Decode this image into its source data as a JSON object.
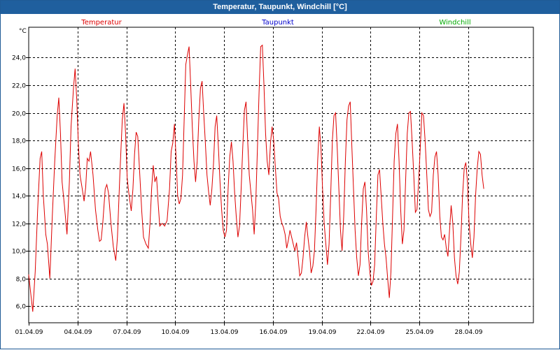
{
  "window": {
    "title": "Temperatur, Taupunkt, Windchill [°C]"
  },
  "colors": {
    "temperature": "#dd0000",
    "dewpoint": "#0000cc",
    "windchill": "#00aa00",
    "titlebar": "#1f5f9e",
    "grid": "#000000"
  },
  "chart_data": {
    "type": "line",
    "title": "Temperatur, Taupunkt, Windchill [°C]",
    "ylabel": "°C",
    "ylim": [
      4.8,
      26.2
    ],
    "xlim": [
      0,
      31
    ],
    "grid": true,
    "legend_position": "top",
    "x_tick_labels": [
      "01.04.09",
      "04.04.09",
      "07.04.09",
      "10.04.09",
      "13.04.09",
      "16.04.09",
      "19.04.09",
      "22.04.09",
      "25.04.09",
      "28.04.09"
    ],
    "x_tick_values": [
      0,
      3,
      6,
      9,
      12,
      15,
      18,
      21,
      24,
      27
    ],
    "y_ticks": [
      6.0,
      8.0,
      10.0,
      12.0,
      14.0,
      16.0,
      18.0,
      20.0,
      22.0,
      24.0
    ],
    "y_tick_labels": [
      "6,0",
      "8,0",
      "10,0",
      "12,0",
      "14,0",
      "16,0",
      "18,0",
      "20,0",
      "22,0",
      "24,0"
    ],
    "series": [
      {
        "name": "Temperatur",
        "color": "#dd0000",
        "points": [
          [
            0,
            8.3
          ],
          [
            0.1,
            7.2
          ],
          [
            0.25,
            5.6
          ],
          [
            0.4,
            8.5
          ],
          [
            0.55,
            13.0
          ],
          [
            0.7,
            16.7
          ],
          [
            0.8,
            17.2
          ],
          [
            0.9,
            14.0
          ],
          [
            1.05,
            11.2
          ],
          [
            1.15,
            10.5
          ],
          [
            1.3,
            8.0
          ],
          [
            1.45,
            12.5
          ],
          [
            1.6,
            16.5
          ],
          [
            1.75,
            19.8
          ],
          [
            1.85,
            21.1
          ],
          [
            1.95,
            18.5
          ],
          [
            2.05,
            15.0
          ],
          [
            2.2,
            13.2
          ],
          [
            2.35,
            11.2
          ],
          [
            2.5,
            15.0
          ],
          [
            2.6,
            19.0
          ],
          [
            2.75,
            21.8
          ],
          [
            2.85,
            23.2
          ],
          [
            2.95,
            21.0
          ],
          [
            3.05,
            17.8
          ],
          [
            3.15,
            15.5
          ],
          [
            3.3,
            14.4
          ],
          [
            3.4,
            13.6
          ],
          [
            3.5,
            14.6
          ],
          [
            3.6,
            16.7
          ],
          [
            3.7,
            16.5
          ],
          [
            3.8,
            17.2
          ],
          [
            3.95,
            15.5
          ],
          [
            4.1,
            13.0
          ],
          [
            4.25,
            11.5
          ],
          [
            4.35,
            10.7
          ],
          [
            4.45,
            10.8
          ],
          [
            4.55,
            12.0
          ],
          [
            4.7,
            14.5
          ],
          [
            4.8,
            14.8
          ],
          [
            4.9,
            14.2
          ],
          [
            5.05,
            12.0
          ],
          [
            5.2,
            10.3
          ],
          [
            5.35,
            9.3
          ],
          [
            5.45,
            11.0
          ],
          [
            5.6,
            15.5
          ],
          [
            5.75,
            19.5
          ],
          [
            5.85,
            20.7
          ],
          [
            5.95,
            18.5
          ],
          [
            6.05,
            15.3
          ],
          [
            6.15,
            14.2
          ],
          [
            6.3,
            12.9
          ],
          [
            6.4,
            14.5
          ],
          [
            6.5,
            17.0
          ],
          [
            6.6,
            18.6
          ],
          [
            6.7,
            18.3
          ],
          [
            6.8,
            16.0
          ],
          [
            6.95,
            12.8
          ],
          [
            7.05,
            11.0
          ],
          [
            7.2,
            10.5
          ],
          [
            7.35,
            10.2
          ],
          [
            7.45,
            12.0
          ],
          [
            7.55,
            14.5
          ],
          [
            7.65,
            16.2
          ],
          [
            7.75,
            15.0
          ],
          [
            7.85,
            15.4
          ],
          [
            7.95,
            13.5
          ],
          [
            8.05,
            11.8
          ],
          [
            8.2,
            12.0
          ],
          [
            8.35,
            11.8
          ],
          [
            8.5,
            12.2
          ],
          [
            8.65,
            14.5
          ],
          [
            8.75,
            17.2
          ],
          [
            8.85,
            17.8
          ],
          [
            8.95,
            19.2
          ],
          [
            9.05,
            16.8
          ],
          [
            9.15,
            14.0
          ],
          [
            9.25,
            13.4
          ],
          [
            9.35,
            13.8
          ],
          [
            9.45,
            15.5
          ],
          [
            9.55,
            19.5
          ],
          [
            9.65,
            23.5
          ],
          [
            9.75,
            24.2
          ],
          [
            9.85,
            24.8
          ],
          [
            9.95,
            22.0
          ],
          [
            10.05,
            19.0
          ],
          [
            10.15,
            16.5
          ],
          [
            10.25,
            15.0
          ],
          [
            10.35,
            16.5
          ],
          [
            10.45,
            19.5
          ],
          [
            10.55,
            21.8
          ],
          [
            10.65,
            22.3
          ],
          [
            10.75,
            20.0
          ],
          [
            10.85,
            17.8
          ],
          [
            10.95,
            15.5
          ],
          [
            11.05,
            14.3
          ],
          [
            11.15,
            13.3
          ],
          [
            11.25,
            14.5
          ],
          [
            11.35,
            16.3
          ],
          [
            11.45,
            19.0
          ],
          [
            11.55,
            19.8
          ],
          [
            11.65,
            17.5
          ],
          [
            11.75,
            15.0
          ],
          [
            11.85,
            13.0
          ],
          [
            11.95,
            11.5
          ],
          [
            12.05,
            11.0
          ],
          [
            12.15,
            11.5
          ],
          [
            12.25,
            14.5
          ],
          [
            12.35,
            16.8
          ],
          [
            12.45,
            17.9
          ],
          [
            12.55,
            16.5
          ],
          [
            12.65,
            14.2
          ],
          [
            12.75,
            12.5
          ],
          [
            12.85,
            11.0
          ],
          [
            12.95,
            11.8
          ],
          [
            13.05,
            14.5
          ],
          [
            13.15,
            17.5
          ],
          [
            13.25,
            20.2
          ],
          [
            13.35,
            20.8
          ],
          [
            13.45,
            18.0
          ],
          [
            13.55,
            15.5
          ],
          [
            13.65,
            14.2
          ],
          [
            13.75,
            13.0
          ],
          [
            13.85,
            11.2
          ],
          [
            13.95,
            13.5
          ],
          [
            14.05,
            17.5
          ],
          [
            14.15,
            21.5
          ],
          [
            14.25,
            24.8
          ],
          [
            14.35,
            24.9
          ],
          [
            14.45,
            22.0
          ],
          [
            14.55,
            18.5
          ],
          [
            14.65,
            16.5
          ],
          [
            14.75,
            15.5
          ],
          [
            14.85,
            17.8
          ],
          [
            14.95,
            19.0
          ],
          [
            15.05,
            18.0
          ],
          [
            15.15,
            16.0
          ],
          [
            15.25,
            14.2
          ],
          [
            15.35,
            13.8
          ],
          [
            15.45,
            12.5
          ],
          [
            15.55,
            12.0
          ],
          [
            15.65,
            11.7
          ],
          [
            15.75,
            11.2
          ],
          [
            15.85,
            10.2
          ],
          [
            15.95,
            10.8
          ],
          [
            16.05,
            11.5
          ],
          [
            16.15,
            11.0
          ],
          [
            16.25,
            10.5
          ],
          [
            16.35,
            10.0
          ],
          [
            16.45,
            10.6
          ],
          [
            16.55,
            9.5
          ],
          [
            16.65,
            8.2
          ],
          [
            16.75,
            8.4
          ],
          [
            16.85,
            9.5
          ],
          [
            16.95,
            11.0
          ],
          [
            17.05,
            12.1
          ],
          [
            17.15,
            11.0
          ],
          [
            17.25,
            10.0
          ],
          [
            17.35,
            8.4
          ],
          [
            17.45,
            8.9
          ],
          [
            17.55,
            10.0
          ],
          [
            17.65,
            13.0
          ],
          [
            17.75,
            16.5
          ],
          [
            17.85,
            19.0
          ],
          [
            17.95,
            17.5
          ],
          [
            18.05,
            14.5
          ],
          [
            18.15,
            12.0
          ],
          [
            18.25,
            10.5
          ],
          [
            18.35,
            9.0
          ],
          [
            18.45,
            10.5
          ],
          [
            18.55,
            14.0
          ],
          [
            18.65,
            18.0
          ],
          [
            18.75,
            19.8
          ],
          [
            18.85,
            20.0
          ],
          [
            18.95,
            17.5
          ],
          [
            19.05,
            14.5
          ],
          [
            19.15,
            11.5
          ],
          [
            19.25,
            10.0
          ],
          [
            19.35,
            12.5
          ],
          [
            19.45,
            16.5
          ],
          [
            19.55,
            19.5
          ],
          [
            19.65,
            20.5
          ],
          [
            19.75,
            20.8
          ],
          [
            19.85,
            17.5
          ],
          [
            19.95,
            14.5
          ],
          [
            20.05,
            11.5
          ],
          [
            20.15,
            9.5
          ],
          [
            20.25,
            8.2
          ],
          [
            20.35,
            9.0
          ],
          [
            20.45,
            12.0
          ],
          [
            20.55,
            14.5
          ],
          [
            20.65,
            15.0
          ],
          [
            20.75,
            13.0
          ],
          [
            20.85,
            10.0
          ],
          [
            20.95,
            8.5
          ],
          [
            21.05,
            7.5
          ],
          [
            21.15,
            7.8
          ],
          [
            21.25,
            9.0
          ],
          [
            21.35,
            12.5
          ],
          [
            21.45,
            15.5
          ],
          [
            21.55,
            15.9
          ],
          [
            21.65,
            14.0
          ],
          [
            21.75,
            12.0
          ],
          [
            21.85,
            10.5
          ],
          [
            21.95,
            9.5
          ],
          [
            22.05,
            8.0
          ],
          [
            22.15,
            6.6
          ],
          [
            22.25,
            8.5
          ],
          [
            22.35,
            12.5
          ],
          [
            22.45,
            16.5
          ],
          [
            22.55,
            18.5
          ],
          [
            22.65,
            19.2
          ],
          [
            22.75,
            16.5
          ],
          [
            22.85,
            13.0
          ],
          [
            22.95,
            10.5
          ],
          [
            23.05,
            11.5
          ],
          [
            23.15,
            15.0
          ],
          [
            23.25,
            18.5
          ],
          [
            23.35,
            20.0
          ],
          [
            23.45,
            20.1
          ],
          [
            23.55,
            18.0
          ],
          [
            23.65,
            15.5
          ],
          [
            23.75,
            12.8
          ],
          [
            23.85,
            13.0
          ],
          [
            23.95,
            15.0
          ],
          [
            24.05,
            17.5
          ],
          [
            24.15,
            20.0
          ],
          [
            24.25,
            19.8
          ],
          [
            24.35,
            18.0
          ],
          [
            24.45,
            15.5
          ],
          [
            24.55,
            13.0
          ],
          [
            24.65,
            12.5
          ],
          [
            24.75,
            12.8
          ],
          [
            24.85,
            15.5
          ],
          [
            24.95,
            16.8
          ],
          [
            25.05,
            17.2
          ],
          [
            25.15,
            15.5
          ],
          [
            25.25,
            12.5
          ],
          [
            25.35,
            11.0
          ],
          [
            25.45,
            10.8
          ],
          [
            25.55,
            11.2
          ],
          [
            25.65,
            10.2
          ],
          [
            25.75,
            9.6
          ],
          [
            25.85,
            11.5
          ],
          [
            25.95,
            13.3
          ],
          [
            26.05,
            12.0
          ],
          [
            26.15,
            9.5
          ],
          [
            26.25,
            8.2
          ],
          [
            26.35,
            7.6
          ],
          [
            26.45,
            8.5
          ],
          [
            26.55,
            11.0
          ],
          [
            26.65,
            14.0
          ],
          [
            26.75,
            16.0
          ],
          [
            26.85,
            16.4
          ],
          [
            26.95,
            15.0
          ],
          [
            27.05,
            12.0
          ],
          [
            27.15,
            10.5
          ],
          [
            27.25,
            9.5
          ],
          [
            27.35,
            11.0
          ],
          [
            27.45,
            14.0
          ],
          [
            27.55,
            16.0
          ],
          [
            27.65,
            17.2
          ],
          [
            27.75,
            17.0
          ],
          [
            27.85,
            15.5
          ],
          [
            27.95,
            14.5
          ]
        ]
      },
      {
        "name": "Taupunkt",
        "color": "#0000cc",
        "points": []
      },
      {
        "name": "Windchill",
        "color": "#00aa00",
        "points": []
      }
    ]
  }
}
